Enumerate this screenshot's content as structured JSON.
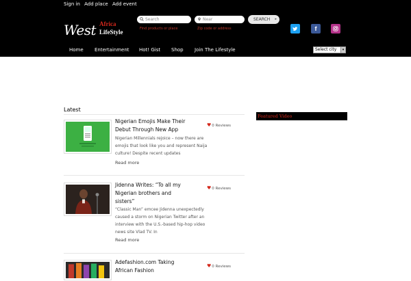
{
  "top_links": [
    "Sign in",
    "Add place",
    "Add event"
  ],
  "logo": {
    "west": "West",
    "africa": "Africa",
    "lifestyle": "LifeStyle"
  },
  "search": {
    "placeholder": "Search",
    "near_placeholder": "Near",
    "hint": "Find products or place",
    "near_hint": "Zip code or address",
    "button": "SEARCH"
  },
  "social": [
    {
      "icon": "twitter-icon",
      "color": "#1da1f2"
    },
    {
      "icon": "facebook-icon",
      "color": "#3b5998"
    },
    {
      "icon": "instagram-icon",
      "color": "#b5338a"
    }
  ],
  "nav": [
    "Home",
    "Entertainment",
    "Hot! Gist",
    "Shop",
    "Join The Lifestyle"
  ],
  "city_select": "Select city",
  "latest_title": "Latest",
  "featured_title": "Featured Video",
  "articles": [
    {
      "title_l1": "Nigerian Emojis Make Their",
      "title_l2": "Debut Through New App",
      "excerpt_l1": "Nigerian Millennials rejoice – now there are",
      "excerpt_l2": "emojis that look like you and represent Naija",
      "excerpt_l3": "culture! Despite recent updates",
      "reviews": "0 Reviews",
      "readmore": "Read more"
    },
    {
      "title_l1": "Jidenna Writes: “To all my",
      "title_l2": "Nigerian brothers and",
      "title_l3": "sisters”",
      "excerpt_l1": "“Classic Man” emcee Jidenna unexpectedly",
      "excerpt_l2": "caused a storm on Nigerian Twitter after an",
      "excerpt_l3": "interview with the U.S.-based hip-hop video",
      "excerpt_l4": "news site Vlad TV. In",
      "reviews": "0 Reviews",
      "readmore": "Read more"
    },
    {
      "title_l1": "Adefashion.com Taking",
      "title_l2": "African Fashion",
      "reviews": "0 Reviews"
    }
  ]
}
